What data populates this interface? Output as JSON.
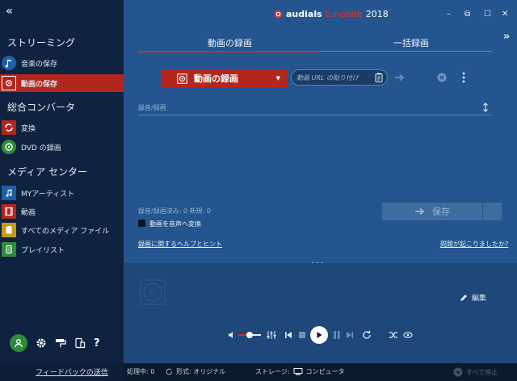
{
  "app": {
    "brand_prefix": "audials",
    "brand_product": "tunebite",
    "brand_year": "2018"
  },
  "sidebar": {
    "sections": [
      "ストリーミング",
      "総合コンバータ",
      "メディア センター"
    ],
    "items": [
      {
        "label": "音楽の保存",
        "icon": "music-save-icon",
        "active": false
      },
      {
        "label": "動画の保存",
        "icon": "video-save-icon",
        "active": true
      },
      {
        "label": "変換",
        "icon": "convert-icon",
        "active": false
      },
      {
        "label": "DVD の録画",
        "icon": "dvd-record-icon",
        "active": false
      },
      {
        "label": "MYアーティスト",
        "icon": "music-note-icon",
        "active": false
      },
      {
        "label": "動画",
        "icon": "film-icon",
        "active": false
      },
      {
        "label": "すべてのメディア ファイル",
        "icon": "media-files-icon",
        "active": false
      },
      {
        "label": "プレイリスト",
        "icon": "playlist-icon",
        "active": false
      }
    ],
    "feedback": "フィードバックの送信"
  },
  "tabs": [
    "動画の録画",
    "一括録画"
  ],
  "toolbar": {
    "record_label": "動画の録画",
    "url_placeholder": "動画 URL の貼り付け"
  },
  "content": {
    "field_placeholder": "録音/録画",
    "stats": "録音/録画済み: 0  新規: 0",
    "convert_label": "動画を音声へ変換",
    "save_label": "保存",
    "help_link": "録画に関するヘルプとヒント",
    "problem_link": "問題が起こりましたか?"
  },
  "player": {
    "edit_label": "編集",
    "volume": 0.5
  },
  "statusbar": {
    "processing": "処理中: 0",
    "format": "形式: オリジナル",
    "storage": "ストレージ:",
    "computer": "コンピュータ",
    "stop_all": "すべて停止"
  },
  "colors": {
    "accent": "#b3261e",
    "main_bg": "#24558f",
    "sidebar_bg": "#0f2340"
  }
}
